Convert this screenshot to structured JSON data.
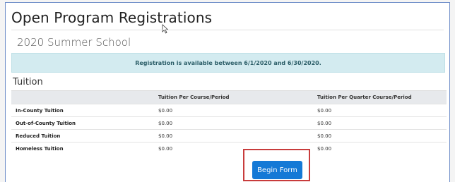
{
  "page": {
    "title": "Open Program Registrations",
    "program_name": "2020 Summer School",
    "availability_message": "Registration is available between 6/1/2020 and 6/30/2020."
  },
  "tuition": {
    "heading": "Tuition",
    "columns": [
      "",
      "Tuition Per Course/Period",
      "Tuition Per Quarter Course/Period"
    ],
    "rows": [
      {
        "label": "In-County Tuition",
        "per_course": "$0.00",
        "per_quarter": "$0.00"
      },
      {
        "label": "Out-of-County Tuition",
        "per_course": "$0.00",
        "per_quarter": "$0.00"
      },
      {
        "label": "Reduced Tuition",
        "per_course": "$0.00",
        "per_quarter": "$0.00"
      },
      {
        "label": "Homeless Tuition",
        "per_course": "$0.00",
        "per_quarter": "$0.00"
      }
    ]
  },
  "actions": {
    "begin_form_label": "Begin Form"
  },
  "colors": {
    "primary_button": "#1479d6",
    "alert_background": "#d3ebf0",
    "highlight_border": "#c83c3c"
  },
  "icons": {
    "cursor": "mouse-pointer-icon"
  }
}
